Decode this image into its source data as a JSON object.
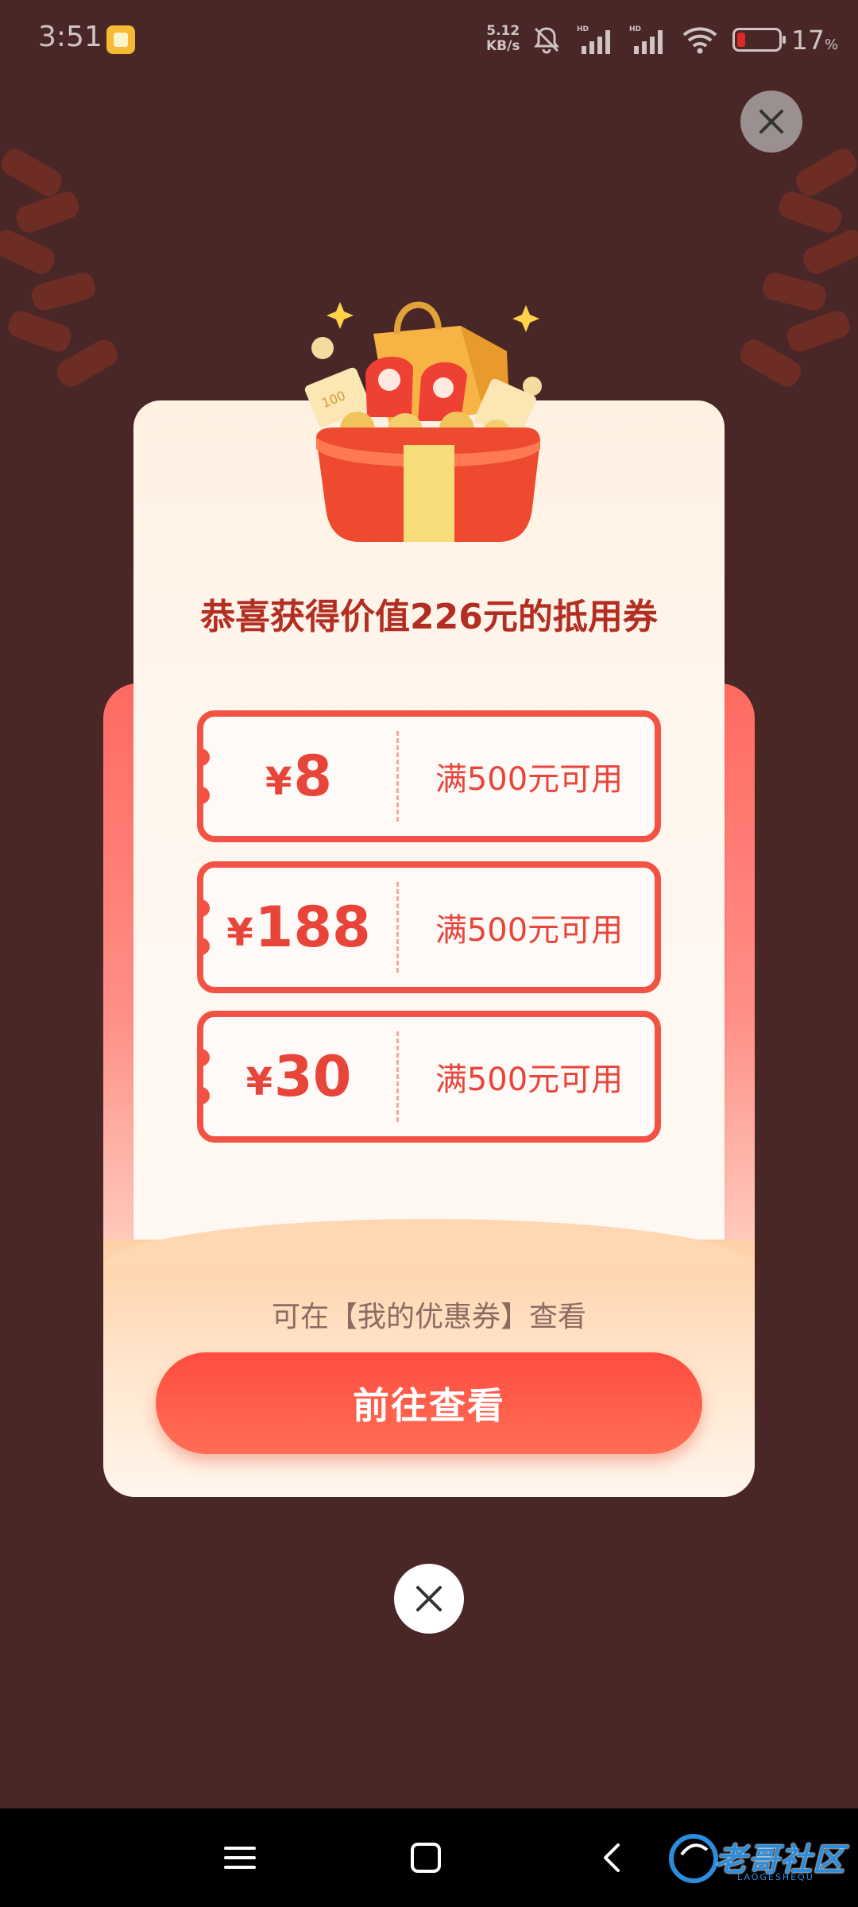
{
  "status_bar": {
    "time": "3:51",
    "net_speed_value": "5.12",
    "net_speed_unit": "KB/s",
    "battery_percent": "17",
    "battery_unit": "%"
  },
  "dialog": {
    "title": "恭喜获得价值226元的抵用券",
    "coupons": [
      {
        "currency": "¥",
        "amount": "8",
        "condition": "满500元可用"
      },
      {
        "currency": "¥",
        "amount": "188",
        "condition": "满500元可用"
      },
      {
        "currency": "¥",
        "amount": "30",
        "condition": "满500元可用"
      }
    ],
    "hint": "可在【我的优惠券】查看",
    "cta_label": "前往查看"
  },
  "watermark": {
    "text": "老哥社区",
    "sub": "LAOGESHEQU"
  },
  "colors": {
    "backdrop": "#4a2727",
    "accent_red": "#f25244",
    "title_red": "#b22e22",
    "cta_gradient_start": "#ff4d40"
  },
  "icons": {
    "top_close": "close-icon",
    "bottom_close": "close-icon",
    "nav": [
      "menu-icon",
      "home-square-icon",
      "back-chevron-icon"
    ]
  }
}
